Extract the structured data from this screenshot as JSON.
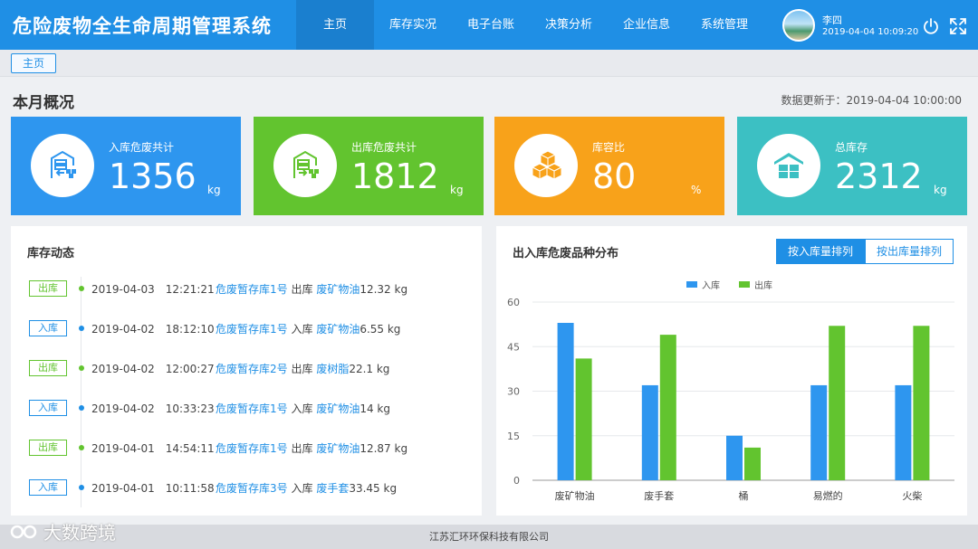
{
  "header": {
    "title": "危险废物全生命周期管理系统",
    "nav": [
      {
        "label": "主页",
        "active": true
      },
      {
        "label": "库存实况",
        "active": false
      },
      {
        "label": "电子台账",
        "active": false
      },
      {
        "label": "决策分析",
        "active": false
      },
      {
        "label": "企业信息",
        "active": false
      },
      {
        "label": "系统管理",
        "active": false
      }
    ],
    "user": {
      "name": "李四",
      "time": "2019-04-04 10:09:20"
    },
    "icons": {
      "power": "power-icon",
      "fullscreen": "fullscreen-icon"
    }
  },
  "breadcrumb": {
    "tab": "主页"
  },
  "overview": {
    "title": "本月概况",
    "update_label": "数据更新于：2019-04-04 10:00:00",
    "cards": [
      {
        "label": "入库危废共计",
        "value": "1356",
        "unit": "kg",
        "color": "#2e96ef",
        "icon": "warehouse-in-icon"
      },
      {
        "label": "出库危废共计",
        "value": "1812",
        "unit": "kg",
        "color": "#62c42f",
        "icon": "warehouse-out-icon"
      },
      {
        "label": "库容比",
        "value": "80",
        "unit": "%",
        "color": "#f8a21a",
        "icon": "boxes-icon"
      },
      {
        "label": "总库存",
        "value": "2312",
        "unit": "kg",
        "color": "#3cc0c3",
        "icon": "storehouse-icon"
      }
    ]
  },
  "inventory": {
    "title": "库存动态",
    "records": [
      {
        "tag": "出库",
        "type": "out",
        "time": "2019-04-03　12:21:21",
        "store": "危废暂存库1号",
        "action": "出库",
        "item": "废矿物油",
        "qty": "12.32 kg"
      },
      {
        "tag": "入库",
        "type": "in",
        "time": "2019-04-02　18:12:10",
        "store": "危废暂存库1号",
        "action": "入库",
        "item": "废矿物油",
        "qty": "6.55 kg"
      },
      {
        "tag": "出库",
        "type": "out",
        "time": "2019-04-02　12:00:27",
        "store": "危废暂存库2号",
        "action": "出库",
        "item": "废树脂",
        "qty": "22.1 kg"
      },
      {
        "tag": "入库",
        "type": "in",
        "time": "2019-04-02　10:33:23",
        "store": "危废暂存库1号",
        "action": "入库",
        "item": "废矿物油",
        "qty": "14 kg"
      },
      {
        "tag": "出库",
        "type": "out",
        "time": "2019-04-01　14:54:11",
        "store": "危废暂存库1号",
        "action": "出库",
        "item": "废矿物油",
        "qty": "12.87 kg"
      },
      {
        "tag": "入库",
        "type": "in",
        "time": "2019-04-01　10:11:58",
        "store": "危废暂存库3号",
        "action": "入库",
        "item": "废手套",
        "qty": "33.45 kg"
      }
    ],
    "colors": {
      "in": "#1f8fe5",
      "out": "#62c42f"
    }
  },
  "distribution": {
    "title": "出入库危废品种分布",
    "sort_in": "按入库量排列",
    "sort_out": "按出库量排列"
  },
  "chart_data": {
    "type": "bar",
    "categories": [
      "废矿物油",
      "废手套",
      "桶",
      "易燃的",
      "火柴"
    ],
    "series": [
      {
        "name": "入库",
        "color": "#2e96ef",
        "values": [
          53,
          32,
          15,
          32,
          32
        ]
      },
      {
        "name": "出库",
        "color": "#62c42f",
        "values": [
          41,
          49,
          11,
          52,
          52
        ]
      }
    ],
    "ylim": [
      0,
      60
    ],
    "yticks": [
      "0",
      "15",
      "30",
      "45",
      "60"
    ],
    "grid": true,
    "legend": "top-center"
  },
  "footer": {
    "text": "江苏汇环环保科技有限公司"
  },
  "watermark": {
    "text": "大数跨境"
  }
}
